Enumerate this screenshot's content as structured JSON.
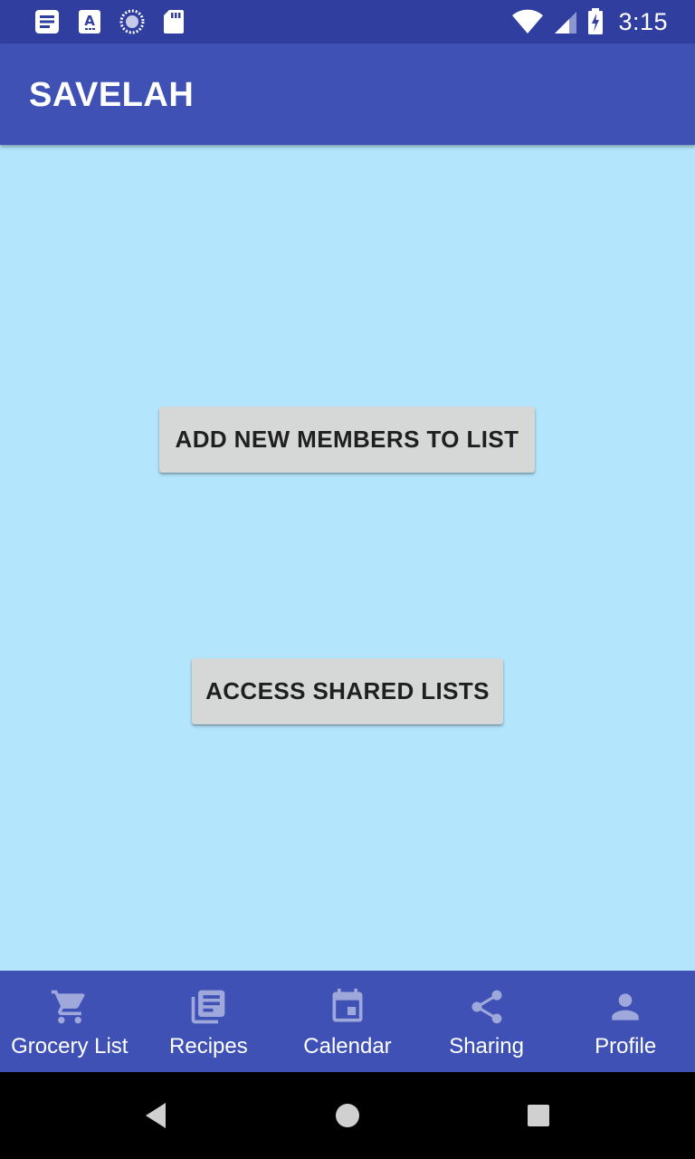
{
  "status_bar": {
    "time": "3:15",
    "left_icons": [
      "notes-icon",
      "keyboard-a-icon",
      "sync-spinner-icon",
      "sd-card-icon"
    ],
    "right_icons": [
      "wifi-icon",
      "cell-signal-icon",
      "battery-charging-icon"
    ]
  },
  "app_bar": {
    "title": "SAVELAH"
  },
  "main": {
    "add_members_label": "ADD NEW MEMBERS TO LIST",
    "access_shared_label": "ACCESS SHARED LISTS"
  },
  "bottom_nav": {
    "items": [
      {
        "label": "Grocery List",
        "icon": "cart-icon"
      },
      {
        "label": "Recipes",
        "icon": "recipes-icon"
      },
      {
        "label": "Calendar",
        "icon": "calendar-icon"
      },
      {
        "label": "Sharing",
        "icon": "share-icon"
      },
      {
        "label": "Profile",
        "icon": "person-icon"
      }
    ]
  },
  "colors": {
    "status_bar": "#303F9F",
    "primary": "#3F51B5",
    "background": "#B3E5FC",
    "button": "#D6D7D7",
    "nav_icon": "#9FA8DA"
  }
}
